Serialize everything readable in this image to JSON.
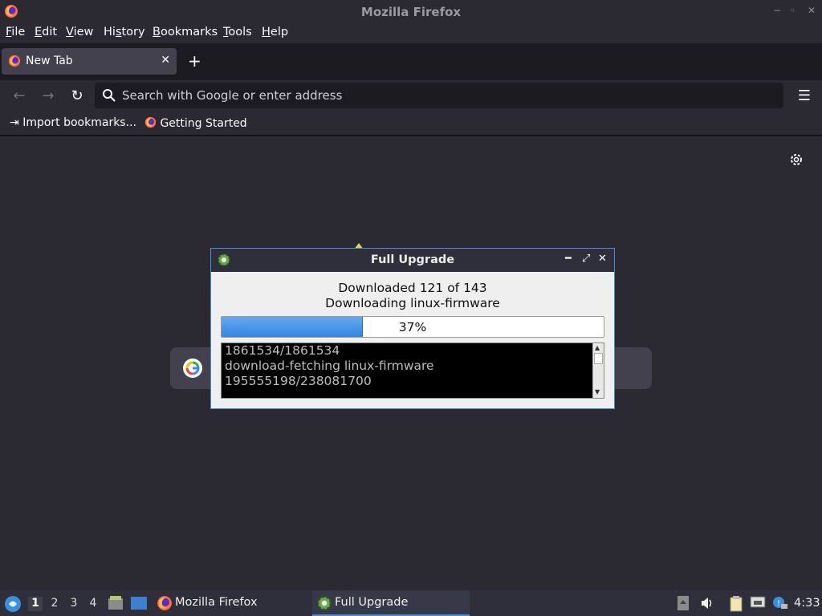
{
  "window": {
    "title": "Mozilla Firefox",
    "controls": [
      "−",
      "◦",
      "✕"
    ]
  },
  "menubar": {
    "items": [
      {
        "label": "File",
        "mnemonic": "F",
        "rest": "ile"
      },
      {
        "label": "Edit",
        "mnemonic": "E",
        "rest": "dit"
      },
      {
        "label": "View",
        "mnemonic": "V",
        "rest": "iew"
      },
      {
        "label": "History",
        "pre": "Hi",
        "mnemonic": "s",
        "rest": "tory"
      },
      {
        "label": "Bookmarks",
        "mnemonic": "B",
        "rest": "ookmarks"
      },
      {
        "label": "Tools",
        "mnemonic": "T",
        "rest": "ools"
      },
      {
        "label": "Help",
        "mnemonic": "H",
        "rest": "elp"
      }
    ]
  },
  "tabs": [
    {
      "label": "New Tab",
      "active": true
    }
  ],
  "navbar": {
    "url_placeholder": "Search with Google or enter address",
    "url_value": ""
  },
  "bookmarks": [
    {
      "label": "Import bookmarks...",
      "icon": "import-icon"
    },
    {
      "label": "Getting Started",
      "icon": "firefox-icon"
    }
  ],
  "dialog": {
    "title": "Full Upgrade",
    "status_line1": "Downloaded 121 of 143",
    "status_line2": "Downloading linux-firmware",
    "progress_percent": 37,
    "progress_label": "37%",
    "log_lines": [
      "1861534/1861534",
      "download-fetching linux-firmware",
      "195555198/238081700"
    ]
  },
  "taskbar": {
    "workspaces": [
      "1",
      "2",
      "3",
      "4"
    ],
    "active_workspace": "1",
    "tasks": [
      {
        "label": "Mozilla Firefox",
        "active": false
      },
      {
        "label": "Full Upgrade",
        "active": true
      }
    ],
    "clock": "4:33"
  },
  "colors": {
    "accent": "#4a90d9",
    "progress_fill": "#3585df",
    "background": "#2b2a33"
  }
}
